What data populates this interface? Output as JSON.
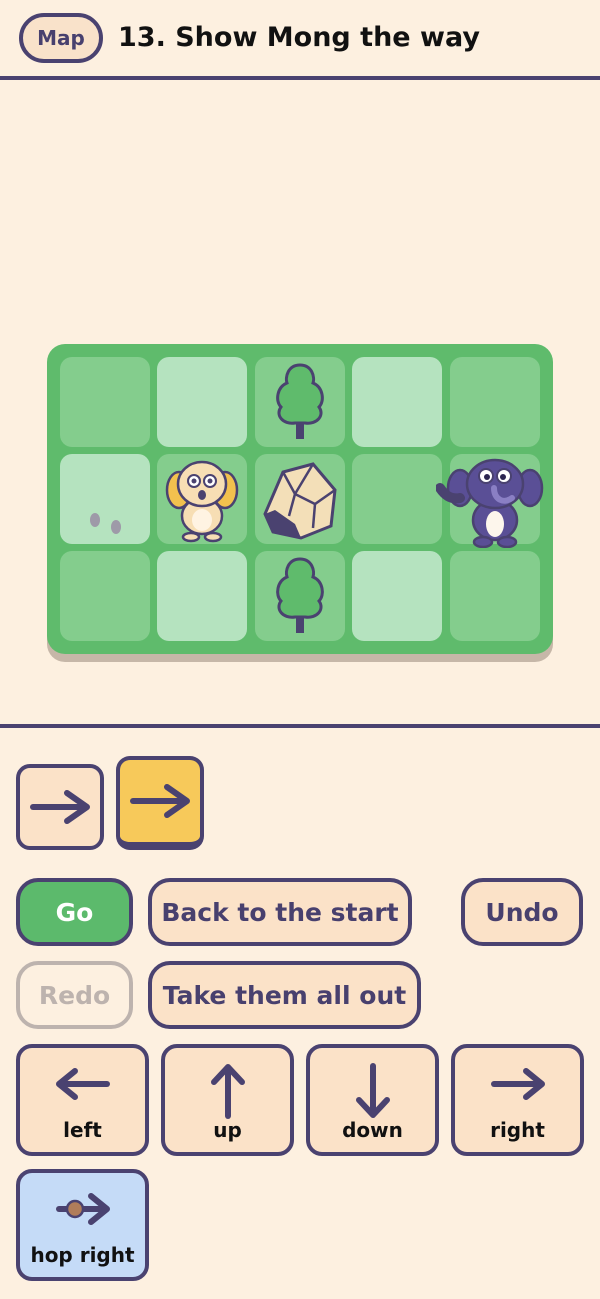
{
  "header": {
    "map_label": "Map",
    "title": "13. Show Mong the way"
  },
  "board": {
    "rows": 3,
    "cols": 5,
    "objects": [
      {
        "row": 0,
        "col": 2,
        "kind": "tree"
      },
      {
        "row": 1,
        "col": 0,
        "kind": "footprints"
      },
      {
        "row": 1,
        "col": 1,
        "kind": "puppy"
      },
      {
        "row": 1,
        "col": 2,
        "kind": "rock"
      },
      {
        "row": 1,
        "col": 4,
        "kind": "mong-elephant"
      },
      {
        "row": 2,
        "col": 2,
        "kind": "tree"
      }
    ]
  },
  "program": {
    "slots": [
      {
        "command": "right",
        "icon": "arrow-right-icon",
        "active": false
      },
      {
        "command": "right",
        "icon": "arrow-right-icon",
        "active": true
      }
    ]
  },
  "controls": {
    "go_label": "Go",
    "back_label": "Back to the start",
    "undo_label": "Undo",
    "redo_label": "Redo",
    "take_out_label": "Take them all out"
  },
  "commands": [
    {
      "label": "left",
      "icon": "arrow-left-icon"
    },
    {
      "label": "up",
      "icon": "arrow-up-icon"
    },
    {
      "label": "down",
      "icon": "arrow-down-icon"
    },
    {
      "label": "right",
      "icon": "arrow-right-icon"
    },
    {
      "label": "hop right",
      "icon": "hop-right-icon"
    }
  ],
  "colors": {
    "background": "#fdf0e0",
    "ink": "#4a4270",
    "board": "#5fbb6c",
    "tile_dark": "#84cd8d",
    "tile_light": "#b5e3bf",
    "go": "#5cba6c",
    "active_slot": "#f7c95a",
    "hop_key": "#c5dbf7"
  }
}
